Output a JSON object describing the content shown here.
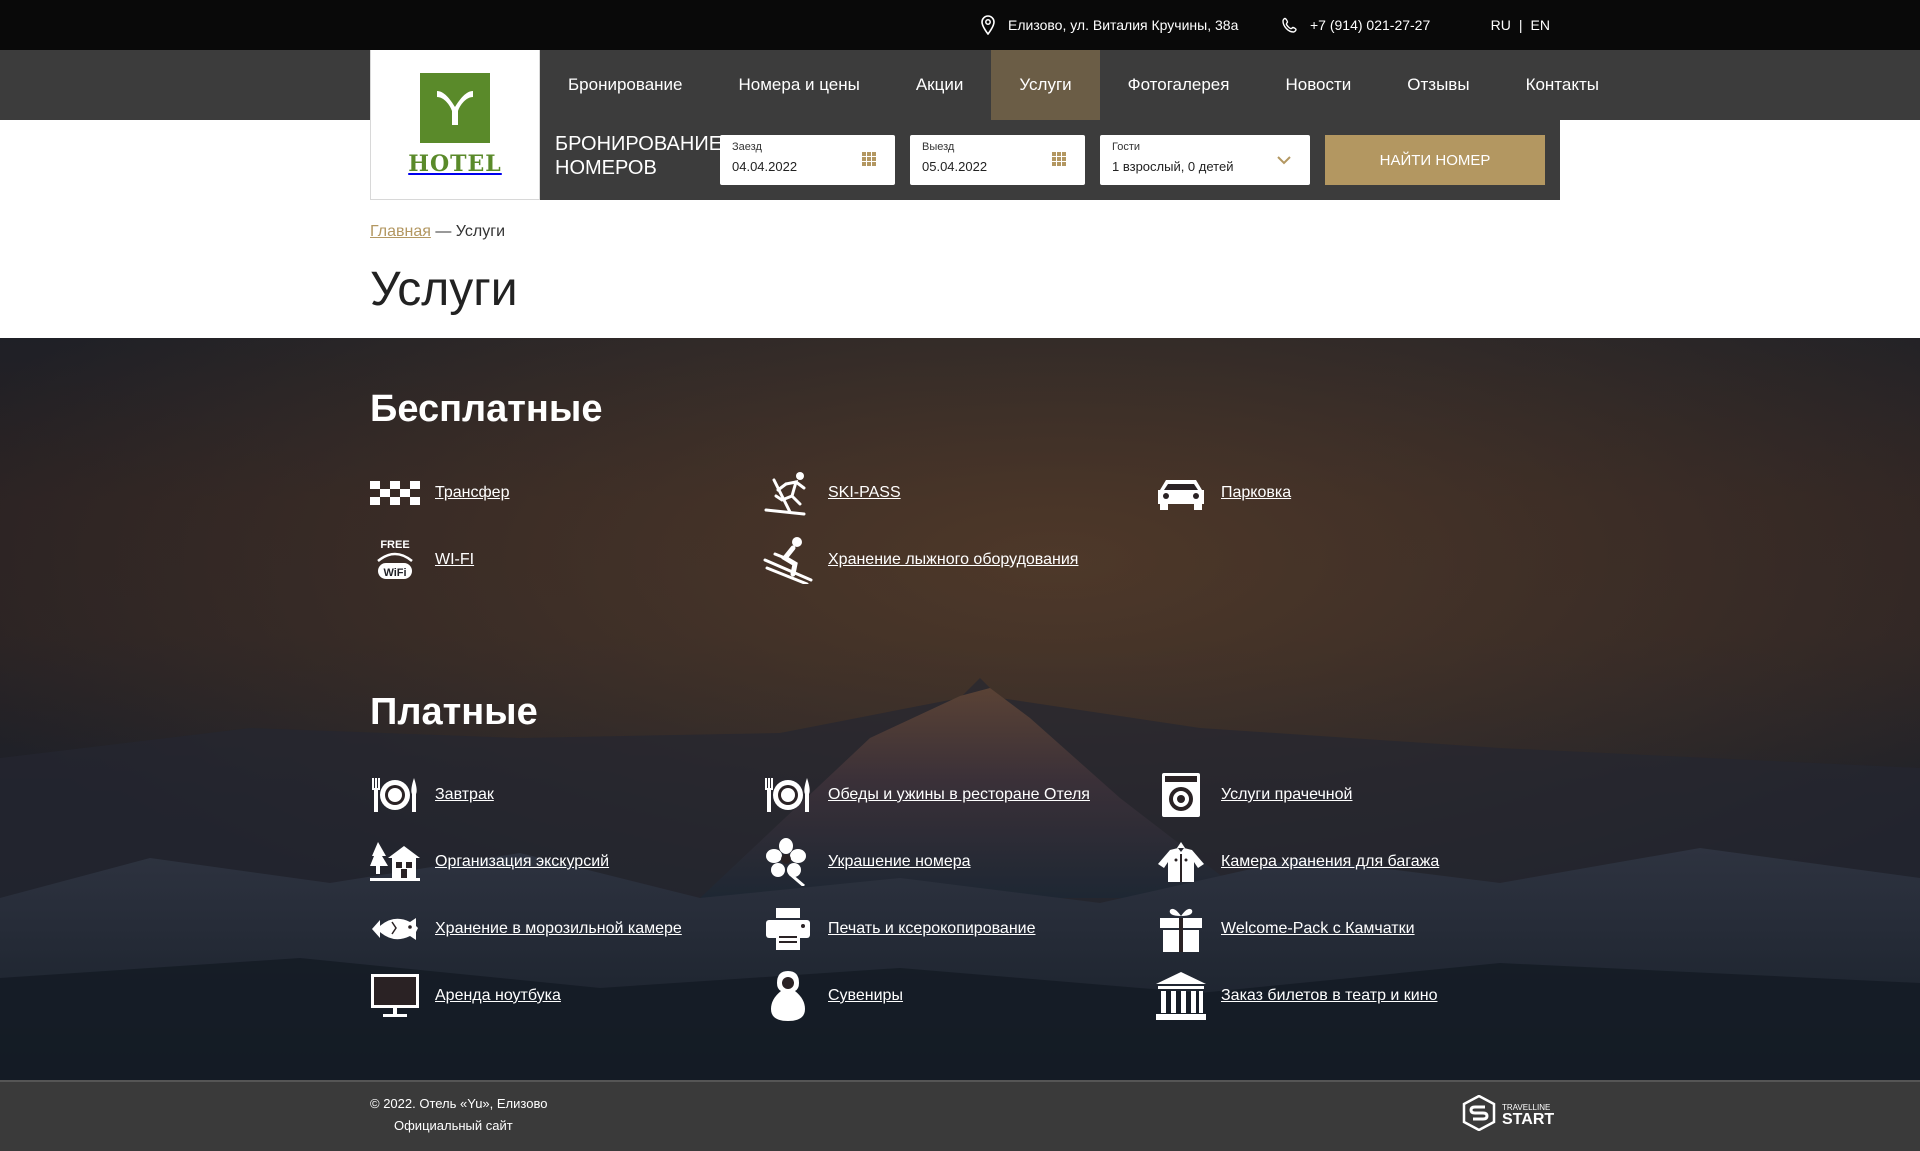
{
  "topbar": {
    "address": "Елизово, ул. Виталия Кручины, 38а",
    "phone": "+7 (914) 021-27-27",
    "lang_ru": "RU",
    "lang_sep": "|",
    "lang_en": "EN"
  },
  "logo": {
    "word": "HOTEL"
  },
  "nav": [
    {
      "label": "Бронирование"
    },
    {
      "label": "Номера и цены"
    },
    {
      "label": "Акции"
    },
    {
      "label": "Услуги",
      "active": true
    },
    {
      "label": "Фотогалерея"
    },
    {
      "label": "Новости"
    },
    {
      "label": "Отзывы"
    },
    {
      "label": "Контакты"
    }
  ],
  "booking": {
    "title": "Бронирование номеров",
    "checkin_label": "Заезд",
    "checkin_value": "04.04.2022",
    "checkout_label": "Выезд",
    "checkout_value": "05.04.2022",
    "guests_label": "Гости",
    "guests_value": "1 взрослый, 0 детей",
    "find_button": "Найти номер"
  },
  "breadcrumb": {
    "home": "Главная",
    "sep": " — ",
    "current": "Услуги"
  },
  "page_title": "Услуги",
  "free": {
    "title": "Бесплатные",
    "items": [
      {
        "label": "Трансфер",
        "icon": "taxi-icon"
      },
      {
        "label": "SKI-PASS",
        "icon": "skier-icon"
      },
      {
        "label": "Парковка",
        "icon": "car-icon"
      },
      {
        "label": "WI-FI",
        "icon": "free-wifi-icon",
        "icon_text": "FREE",
        "icon_text2": "WiFi"
      },
      {
        "label": "Хранение лыжного оборудования",
        "icon": "downhill-skier-icon"
      }
    ]
  },
  "paid": {
    "title": "Платные",
    "items": [
      {
        "label": "Завтрак",
        "icon": "plate-icon"
      },
      {
        "label": "Обеды и ужины в ресторане Отеля",
        "icon": "plate-icon"
      },
      {
        "label": "Услуги прачечной",
        "icon": "washing-machine-icon"
      },
      {
        "label": "Организация экскурсий",
        "icon": "cabin-icon"
      },
      {
        "label": "Украшение номера",
        "icon": "flower-icon"
      },
      {
        "label": "Камера хранения для багажа",
        "icon": "wardrobe-icon"
      },
      {
        "label": "Хранение в морозильной камере",
        "icon": "fish-icon"
      },
      {
        "label": "Печать и ксерокопирование",
        "icon": "printer-icon"
      },
      {
        "label": "Welcome-Pack с Камчатки",
        "icon": "gift-icon"
      },
      {
        "label": "Аренда ноутбука",
        "icon": "monitor-icon"
      },
      {
        "label": "Сувениры",
        "icon": "matryoshka-icon"
      },
      {
        "label": "Заказ билетов в театр и кино",
        "icon": "theater-icon"
      }
    ]
  },
  "footer": {
    "copyright": "© 2022. Отель «Yu», Елизово",
    "official": "Официальный сайт",
    "tl_small1": "TRAVELLINE",
    "tl_big": "START"
  },
  "colors": {
    "accent": "#b39761",
    "nav_bg": "#3c3c3c",
    "nav_active": "#6b5d46",
    "logo_green": "#5a8a2a",
    "topbar_bg": "#090909"
  }
}
